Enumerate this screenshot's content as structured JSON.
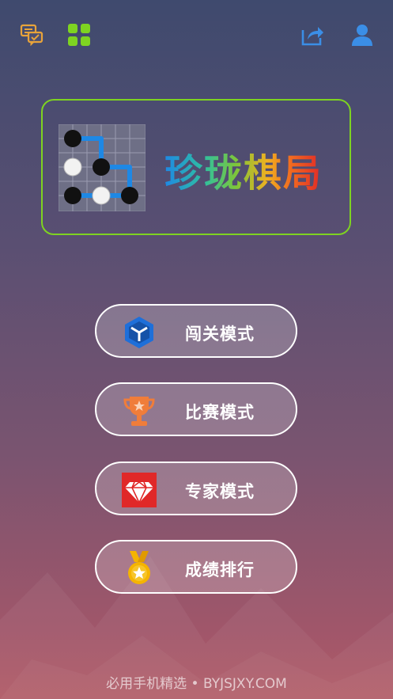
{
  "header": {
    "feedback_icon": "feedback-chat-icon",
    "more_apps_icon": "grid-apps-icon",
    "share_icon": "share-icon",
    "profile_icon": "user-icon"
  },
  "logo": {
    "title": "珍珑棋局",
    "board_icon": "go-board-icon"
  },
  "menu": [
    {
      "label": "闯关模式",
      "icon": "cube-icon",
      "color": "#1e6fd9"
    },
    {
      "label": "比赛模式",
      "icon": "trophy-icon",
      "color": "#f07d3a"
    },
    {
      "label": "专家模式",
      "icon": "diamond-icon",
      "color": "#e02828"
    },
    {
      "label": "成绩排行",
      "icon": "medal-icon",
      "color": "#f5b400"
    }
  ],
  "footer": {
    "text": "必用手机精选 • BYJSJXY.COM"
  },
  "colors": {
    "accent_green": "#7ed321",
    "icon_blue": "#3b8ee6",
    "icon_orange": "#e8a33a"
  }
}
